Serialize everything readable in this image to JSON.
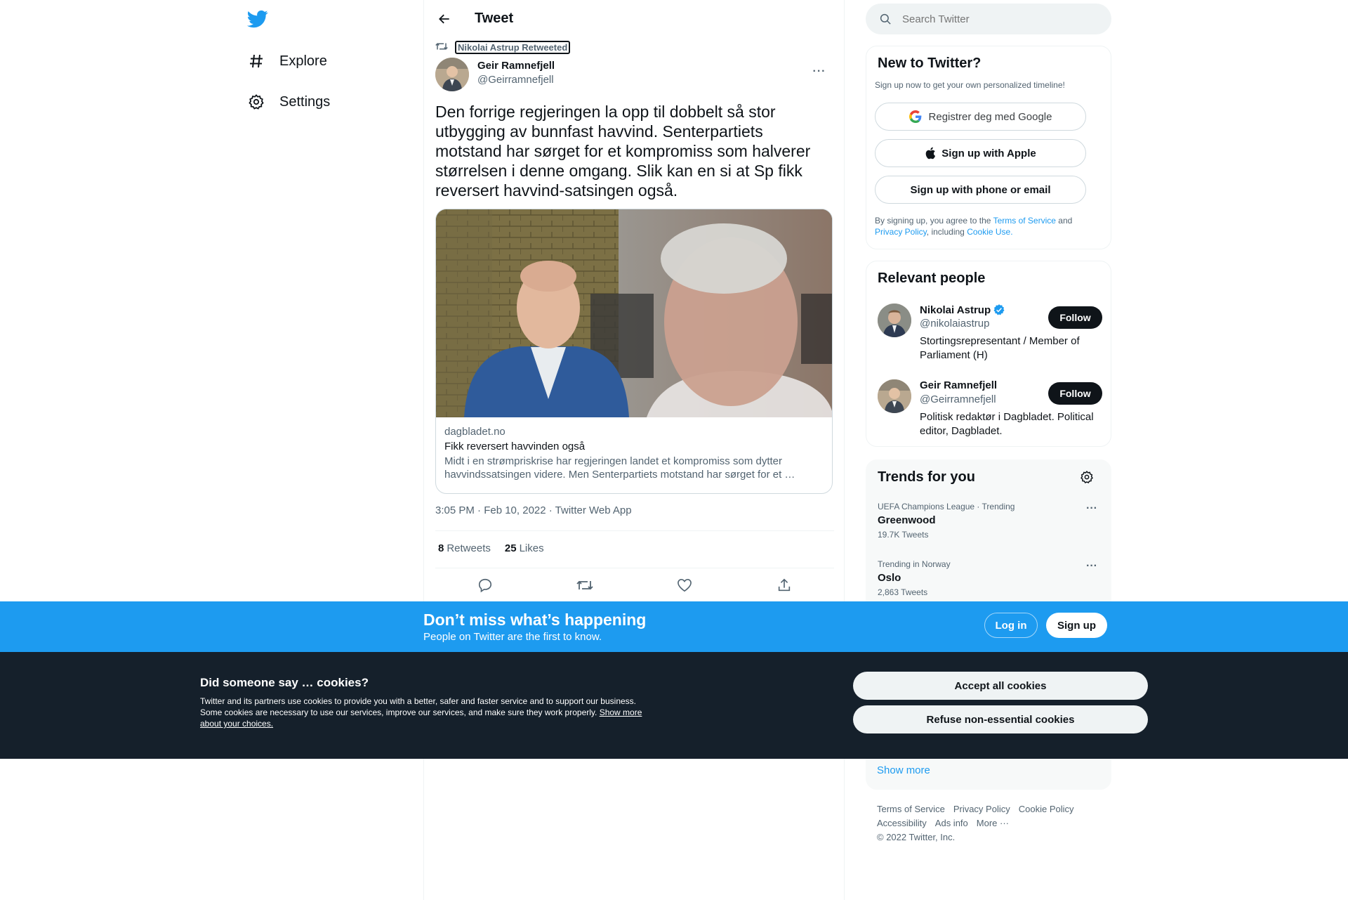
{
  "nav": {
    "items": [
      {
        "label": "Explore",
        "icon": "hashtag-icon"
      },
      {
        "label": "Settings",
        "icon": "gear-icon"
      }
    ]
  },
  "header": {
    "title": "Tweet"
  },
  "tweet": {
    "retweeted_by": "Nikolai Astrup Retweeted",
    "author_name": "Geir Ramnefjell",
    "author_handle": "@Geirramnefjell",
    "text": "Den forrige regjeringen la opp til dobbelt så stor utbygging av bunnfast havvind. Senterpartiets motstand har sørget for et kompromiss som halverer størrelsen i denne omgang. Slik kan en si at Sp fikk reversert havvind-satsingen også.",
    "card": {
      "domain": "dagbladet.no",
      "title": "Fikk reversert havvinden også",
      "description": "Midt i en strømpriskrise har regjeringen landet et kompromiss som dytter havvindssatsingen videre. Men Senterpartiets motstand har sørget for et …"
    },
    "meta": "3:05 PM · Feb 10, 2022 · Twitter Web App",
    "retweets_count": "8",
    "retweets_label": "Retweets",
    "likes_count": "25",
    "likes_label": "Likes"
  },
  "search": {
    "placeholder": "Search Twitter"
  },
  "new_to_twitter": {
    "title": "New to Twitter?",
    "subtitle": "Sign up now to get your own personalized timeline!",
    "google_button": "Registrer deg med Google",
    "apple_button": "Sign up with Apple",
    "phone_button": "Sign up with phone or email",
    "legal_prefix": "By signing up, you agree to the",
    "terms": "Terms of Service",
    "and": "and",
    "privacy": "Privacy Policy",
    "including": ", including",
    "cookie_use": "Cookie Use."
  },
  "relevant_people": {
    "title": "Relevant people",
    "people": [
      {
        "name": "Nikolai Astrup",
        "handle": "@nikolaiastrup",
        "bio": "Stortingsrepresentant / Member of Parliament (H)",
        "verified": true,
        "follow": "Follow"
      },
      {
        "name": "Geir Ramnefjell",
        "handle": "@Geirramnefjell",
        "bio": "Politisk redaktør i Dagbladet. Political editor, Dagbladet.",
        "verified": false,
        "follow": "Follow"
      }
    ]
  },
  "trends": {
    "title": "Trends for you",
    "items": [
      {
        "context": "UEFA Champions League · Trending",
        "name": "Greenwood",
        "count": "19.7K Tweets"
      },
      {
        "context": "Trending in Norway",
        "name": "Oslo",
        "count": "2,863 Tweets"
      }
    ],
    "show_more": "Show more"
  },
  "footer": {
    "links": [
      "Terms of Service",
      "Privacy Policy",
      "Cookie Policy",
      "Accessibility",
      "Ads info",
      "More ···"
    ],
    "copyright": "© 2022 Twitter, Inc."
  },
  "banner": {
    "title": "Don’t miss what’s happening",
    "subtitle": "People on Twitter are the first to know.",
    "login": "Log in",
    "signup": "Sign up"
  },
  "cookies": {
    "title": "Did someone say … cookies?",
    "body": "Twitter and its partners use cookies to provide you with a better, safer and faster service and to support our business. Some cookies are necessary to use our services, improve our services, and make sure they work properly.",
    "link": "Show more about your choices.",
    "accept": "Accept all cookies",
    "refuse": "Refuse non-essential cookies"
  },
  "colors": {
    "accent": "#1d9bf0",
    "text": "#0f1419",
    "muted": "#536471",
    "cookie_bg": "#15202b"
  }
}
